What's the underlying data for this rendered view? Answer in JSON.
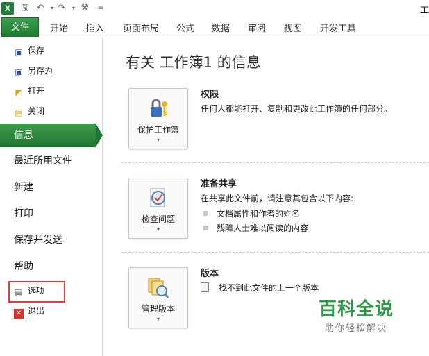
{
  "window": {
    "title_fragment": "工"
  },
  "ribbon": {
    "tabs": [
      "文件",
      "开始",
      "插入",
      "页面布局",
      "公式",
      "数据",
      "审阅",
      "视图",
      "开发工具"
    ]
  },
  "backstage": {
    "small_items": [
      {
        "label": "保存",
        "icon": "save-icon"
      },
      {
        "label": "另存为",
        "icon": "save-as-icon"
      },
      {
        "label": "打开",
        "icon": "open-folder-icon"
      },
      {
        "label": "关闭",
        "icon": "close-folder-icon"
      }
    ],
    "selected": "信息",
    "big_items": [
      "最近所用文件",
      "新建",
      "打印",
      "保存并发送",
      "帮助"
    ],
    "bottom_items": [
      {
        "label": "选项",
        "icon": "options-icon"
      },
      {
        "label": "退出",
        "icon": "exit-icon"
      }
    ]
  },
  "main": {
    "title": "有关 工作簿1 的信息",
    "sections": [
      {
        "button_label": "保护工作簿",
        "title": "权限",
        "text": "任何人都能打开、复制和更改此工作簿的任何部分。"
      },
      {
        "button_label": "检查问题",
        "title": "准备共享",
        "text": "在共享此文件前，请注意其包含以下内容:",
        "bullets": [
          "文档属性和作者的姓名",
          "残障人士难以阅读的内容"
        ]
      },
      {
        "button_label": "管理版本",
        "title": "版本",
        "text": "找不到此文件的上一个版本"
      }
    ]
  },
  "watermark": {
    "main": "百科全说",
    "sub": "助你轻松解决"
  },
  "colors": {
    "accent": "#2e8b3d",
    "highlight_box": "#e0403c"
  }
}
